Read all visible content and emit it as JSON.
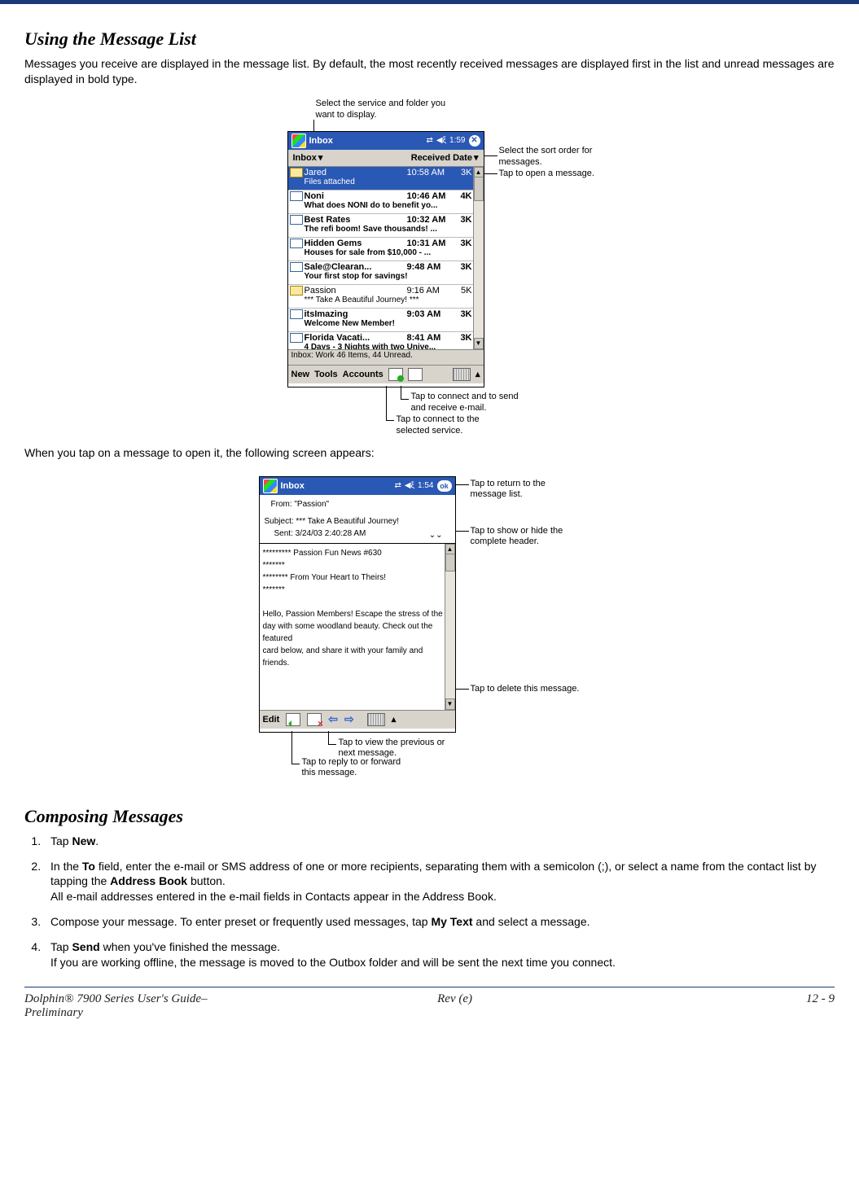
{
  "section1_title": "Using the Message List",
  "para1": "Messages you receive are displayed in the message list. By default, the most recently received messages are displayed first in the list and unread messages are displayed in bold type.",
  "para2": "When you tap on a message to open it, the following screen appears:",
  "section2_title": "Composing Messages",
  "steps": {
    "s1a": "Tap ",
    "s1b": "New",
    "s1c": ".",
    "s2a": "In the ",
    "s2b": "To",
    "s2c": " field, enter the e-mail or SMS address of one or more recipients, separating them with a semicolon (;), or select a name from the contact list by tapping the ",
    "s2d": "Address Book",
    "s2e": " button.",
    "s2f": "All e-mail addresses entered in the e-mail fields in Contacts appear in the Address Book.",
    "s3a": "Compose your message. To enter preset or frequently used messages, tap ",
    "s3b": "My Text",
    "s3c": " and select a message.",
    "s4a": "Tap ",
    "s4b": "Send",
    "s4c": " when you've finished the message.",
    "s4d": "If you are working offline, the message is moved to the Outbox folder and will be sent the next time you connect."
  },
  "fig1": {
    "title": "Inbox",
    "time": "1:59",
    "sub_left": "Inbox",
    "sub_right": "Received Date",
    "messages": [
      {
        "sender": "Jared",
        "time": "10:58 AM",
        "size": "3K",
        "subject": "Files attached",
        "unread": false,
        "selected": true
      },
      {
        "sender": "Noni",
        "time": "10:46 AM",
        "size": "4K",
        "subject": "What does NONI do to benefit yo...",
        "unread": true
      },
      {
        "sender": "Best Rates",
        "time": "10:32 AM",
        "size": "3K",
        "subject": "The refi boom! Save thousands! ...",
        "unread": true
      },
      {
        "sender": "Hidden Gems",
        "time": "10:31 AM",
        "size": "3K",
        "subject": "Houses for sale from $10,000 - ...",
        "unread": true
      },
      {
        "sender": "Sale@Clearan...",
        "time": "9:48 AM",
        "size": "3K",
        "subject": "Your first stop for savings!",
        "unread": true
      },
      {
        "sender": "Passion",
        "time": "9:16 AM",
        "size": "5K",
        "subject": "*** Take A Beautiful Journey! ***",
        "unread": false
      },
      {
        "sender": "itsImazing",
        "time": "9:03 AM",
        "size": "3K",
        "subject": "Welcome New Member!",
        "unread": true
      },
      {
        "sender": "Florida Vacati...",
        "time": "8:41 AM",
        "size": "3K",
        "subject": "4 Days - 3 Nights with two Unive...",
        "unread": true
      }
    ],
    "status": "Inbox: Work  46 Items, 44 Unread.",
    "menu": {
      "new": "New",
      "tools": "Tools",
      "accounts": "Accounts"
    },
    "callouts": {
      "top": "Select the service and folder you want to display.",
      "sort": "Select the sort order for messages.",
      "open": "Tap to open a message.",
      "connect": "Tap to connect to the selected service.",
      "sendrecv": "Tap to connect and to send and receive e-mail."
    }
  },
  "fig2": {
    "title": "Inbox",
    "time": "1:54",
    "ok": "ok",
    "from_label": "From: \"Passion\"",
    "subject_label": "Subject: *** Take A Beautiful Journey!",
    "sent_label": "Sent: 3/24/03 2:40:28 AM",
    "body_lines": [
      "********* Passion     Fun News #630",
      "*******",
      "******** From Your Heart to Theirs!",
      "*******",
      "",
      "Hello, Passion     Members! Escape the stress of the",
      "day with some woodland beauty.  Check out the featured",
      "card below, and share it with your family and friends."
    ],
    "menu_edit": "Edit",
    "callouts": {
      "return": "Tap to return to the message list.",
      "header": "Tap to show or hide the complete header.",
      "delete": "Tap to delete this message.",
      "reply": "Tap to reply to or forward this message.",
      "prevnext": "Tap to view the previous or next message."
    }
  },
  "footer": {
    "left1": "Dolphin® 7900 Series User's Guide–",
    "left2": "Preliminary",
    "center": "Rev (e)",
    "right": "12 - 9"
  }
}
